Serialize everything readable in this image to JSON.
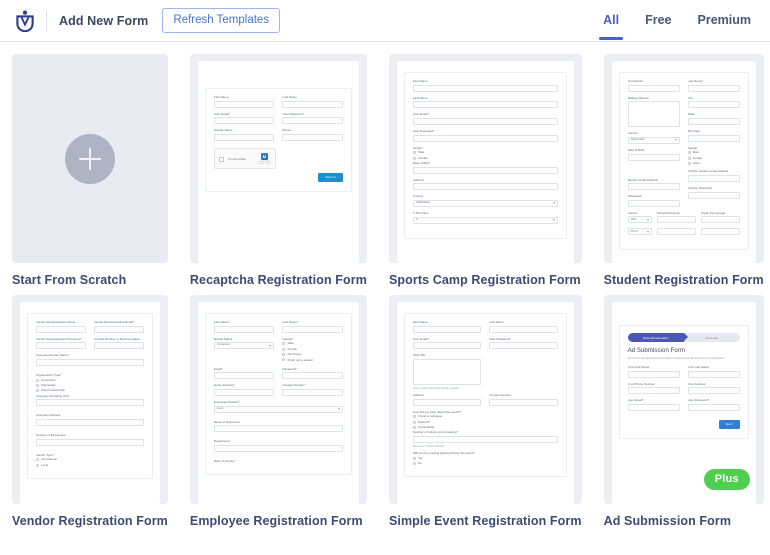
{
  "topbar": {
    "logo_icon": "wpforms-logo-icon",
    "add_new_form": "Add New Form",
    "refresh_templates": "Refresh Templates",
    "filters": [
      {
        "label": "All",
        "active": true
      },
      {
        "label": "Free",
        "active": false
      },
      {
        "label": "Premium",
        "active": false
      }
    ]
  },
  "cards": [
    {
      "title": "Start From Scratch",
      "kind": "scratch",
      "plus_icon": "plus-icon"
    },
    {
      "title": "Recaptcha Registration Form",
      "kind": "form",
      "fields": [
        {
          "label": "First Name",
          "req": false,
          "type": "text",
          "col": "left"
        },
        {
          "label": "Last Name",
          "req": false,
          "type": "text",
          "col": "right"
        },
        {
          "label": "User Email",
          "req": true,
          "type": "text",
          "col": "left"
        },
        {
          "label": "User Password",
          "req": true,
          "type": "text",
          "col": "right"
        },
        {
          "label": "Display Name",
          "req": false,
          "type": "text",
          "col": "left"
        },
        {
          "label": "Phone",
          "req": false,
          "type": "text",
          "col": "right"
        }
      ],
      "recaptcha": {
        "label": "I'm not a robot",
        "brand": "reCAPTCHA",
        "terms": "Privacy - Terms",
        "icon": "recaptcha-icon"
      },
      "submit_label": "Submit"
    },
    {
      "title": "Sports Camp Registration Form",
      "kind": "form",
      "fields": [
        {
          "label": "First Name",
          "req": false,
          "type": "text"
        },
        {
          "label": "Last Name",
          "req": false,
          "type": "text"
        },
        {
          "label": "User Email",
          "req": true,
          "type": "text"
        },
        {
          "label": "User Password",
          "req": true,
          "type": "text"
        },
        {
          "label": "Gender",
          "req": false,
          "type": "radio",
          "options": [
            "Male",
            "Female"
          ]
        },
        {
          "label": "Date of Birth",
          "req": false,
          "type": "text"
        },
        {
          "label": "Address",
          "req": false,
          "type": "text"
        },
        {
          "label": "Country",
          "req": false,
          "type": "select",
          "value": "Afghanistan"
        },
        {
          "label": "T-Shirt Size",
          "req": false,
          "type": "select",
          "value": "S"
        }
      ]
    },
    {
      "title": "Student Registration Form",
      "kind": "form",
      "fields": [
        {
          "label": "First Name",
          "req": true,
          "type": "text",
          "col": "left"
        },
        {
          "label": "Last Name",
          "req": true,
          "type": "text",
          "col": "right"
        },
        {
          "label": "Mailing Address",
          "req": false,
          "type": "textarea",
          "col": "left"
        },
        {
          "label": "City",
          "req": false,
          "type": "text",
          "col": "right"
        },
        {
          "label": "State",
          "req": false,
          "type": "text",
          "col": "right"
        },
        {
          "label": "Country",
          "req": false,
          "type": "select",
          "value": "Afghanistan",
          "col": "left"
        },
        {
          "label": "Zip Code",
          "req": false,
          "type": "text",
          "col": "right"
        },
        {
          "label": "Date of Birth",
          "req": false,
          "type": "text",
          "col": "left"
        },
        {
          "label": "Gender",
          "req": false,
          "type": "radio",
          "options": [
            "Male",
            "Female",
            "Other"
          ],
          "col": "right"
        },
        {
          "label": "Student email address",
          "req": true,
          "type": "text",
          "col": "left"
        },
        {
          "label": "Confirm student email address",
          "req": false,
          "type": "text",
          "col": "right"
        },
        {
          "label": "Password",
          "req": true,
          "type": "text",
          "col": "left"
        },
        {
          "label": "Confirm Password",
          "req": false,
          "type": "text",
          "col": "right"
        }
      ],
      "table": {
        "headers": [
          "Course",
          "School/University",
          "Grade Percentage"
        ],
        "rows": [
          {
            "course": "SSC"
          },
          {
            "course": "Plus 2"
          }
        ]
      }
    },
    {
      "title": "Vendor Registration Form",
      "kind": "form",
      "fields": [
        {
          "label": "Vendor Representative Name",
          "req": false,
          "type": "text",
          "col": "left"
        },
        {
          "label": "Vendor Representative Email",
          "req": true,
          "type": "text",
          "col": "right"
        },
        {
          "label": "Vendor Representative Password",
          "req": true,
          "type": "text",
          "col": "left"
        },
        {
          "label": "Contact Number of Representative",
          "req": false,
          "type": "text",
          "col": "right"
        },
        {
          "label": "Company/Vendor Name",
          "req": true,
          "type": "text",
          "col": "full"
        },
        {
          "label": "Organization Type",
          "req": true,
          "type": "radio",
          "options": [
            "Corporation",
            "Partnership",
            "Sole Proprietorship"
          ],
          "col": "full"
        },
        {
          "label": "Company Founding Year",
          "req": false,
          "type": "text",
          "col": "full"
        },
        {
          "label": "Company Address",
          "req": false,
          "type": "text",
          "col": "full"
        },
        {
          "label": "Number of Employees",
          "req": false,
          "type": "text",
          "col": "full"
        },
        {
          "label": "Vendor Type",
          "req": true,
          "type": "radio",
          "options": [
            "International",
            "Local"
          ],
          "col": "full"
        }
      ]
    },
    {
      "title": "Employee Registration Form",
      "kind": "form",
      "fields": [
        {
          "label": "First Name",
          "req": true,
          "type": "text",
          "col": "left"
        },
        {
          "label": "Last Name",
          "req": true,
          "type": "text",
          "col": "right"
        },
        {
          "label": "Marital Status",
          "req": false,
          "type": "select",
          "value": "Unmarried",
          "col": "left"
        },
        {
          "label": "Gender",
          "req": true,
          "type": "radio",
          "options": [
            "Male",
            "Female",
            "Non-binary",
            "Prefer not to answer"
          ],
          "col": "right"
        },
        {
          "label": "Email",
          "req": true,
          "type": "text",
          "col": "left"
        },
        {
          "label": "Password",
          "req": true,
          "type": "text",
          "col": "right"
        },
        {
          "label": "Home Address",
          "req": true,
          "type": "text",
          "col": "left"
        },
        {
          "label": "Contact Number",
          "req": true,
          "type": "text",
          "col": "right"
        },
        {
          "label": "Employee Position",
          "req": true,
          "type": "select",
          "value": "Intern",
          "col": "full"
        },
        {
          "label": "Name of Supervisor",
          "req": false,
          "type": "text",
          "col": "full"
        },
        {
          "label": "Department",
          "req": false,
          "type": "text",
          "col": "full"
        },
        {
          "label": "Date of Joining",
          "req": true,
          "type": "text",
          "col": "full"
        }
      ]
    },
    {
      "title": "Simple Event Registration Form",
      "kind": "form",
      "fields": [
        {
          "label": "First Name",
          "req": false,
          "type": "text",
          "col": "left"
        },
        {
          "label": "Last Name",
          "req": false,
          "type": "text",
          "col": "right"
        },
        {
          "label": "User Email",
          "req": true,
          "type": "text",
          "col": "left"
        },
        {
          "label": "User Password",
          "req": true,
          "type": "text",
          "col": "right"
        },
        {
          "label": "Short Bio",
          "req": false,
          "type": "textarea",
          "hint": "Share a little information about yourself",
          "col": "left"
        },
        {
          "label": "Address",
          "req": false,
          "type": "text",
          "col": "left"
        },
        {
          "label": "Contact Number",
          "req": false,
          "type": "text",
          "col": "right"
        },
        {
          "label": "How did you hear about this event?",
          "req": true,
          "type": "radio",
          "options": [
            "Friend or colleague",
            "Radio/TV",
            "Social Media"
          ],
          "col": "full"
        },
        {
          "label": "Number of tickets you're booking",
          "req": true,
          "type": "text",
          "hint": "Maximum 5 tickets allowed",
          "col": "full"
        },
        {
          "label": "Will you be needing parking during this event?",
          "req": false,
          "type": "radio",
          "options": [
            "Yes",
            "No"
          ],
          "col": "full"
        }
      ]
    },
    {
      "title": "Ad Submission Form",
      "kind": "ad",
      "badge": "Plus",
      "wizard": [
        {
          "label": "Personal Information",
          "active": true
        },
        {
          "label": "Ad Details",
          "active": false
        }
      ],
      "form_title": "Ad Submission Form",
      "form_desc": "Fill out the ad submission form below to submit your advertisement for publication.",
      "fields": [
        {
          "label": "Your First Name",
          "req": false,
          "type": "text",
          "col": "left"
        },
        {
          "label": "Your Last Name",
          "req": false,
          "type": "text",
          "col": "right"
        },
        {
          "label": "Your Phone Number",
          "req": false,
          "type": "text",
          "col": "left"
        },
        {
          "label": "Your Address",
          "req": false,
          "type": "text",
          "col": "right"
        },
        {
          "label": "User Email",
          "req": true,
          "type": "text",
          "col": "left"
        },
        {
          "label": "User Password",
          "req": true,
          "type": "text",
          "col": "right"
        }
      ],
      "next_label": "Next"
    }
  ]
}
